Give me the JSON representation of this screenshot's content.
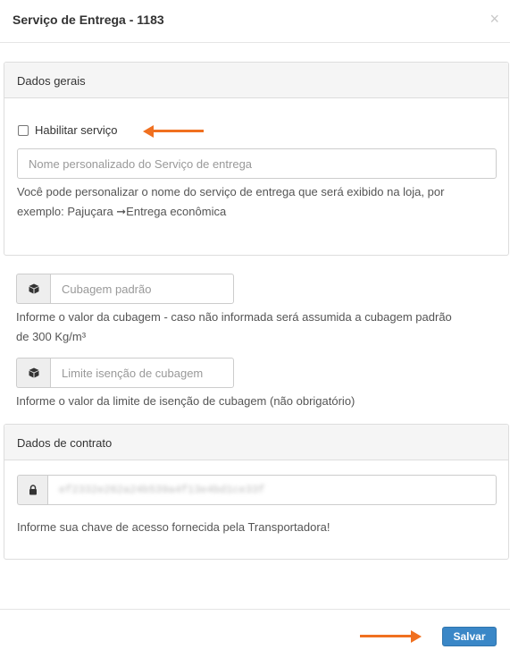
{
  "modal": {
    "title": "Serviço de Entrega - 1183",
    "close_icon": "×"
  },
  "general": {
    "heading": "Dados gerais",
    "enable_label": "Habilitar serviço",
    "enable_checked": false,
    "name_placeholder": "Nome personalizado do Serviço de entrega",
    "help_line1": "Você pode personalizar o nome do serviço de entrega que será exibido na loja, por",
    "help_line2": "exemplo: Pajuçara ➞Entrega econômica"
  },
  "cubage": {
    "placeholder": "Cubagem padrão",
    "icon": "cube-icon",
    "help_line1": "Informe o valor da cubagem - caso não informada será assumida a cubagem padrão",
    "help_line2": "de 300 Kg/m³"
  },
  "exemption": {
    "placeholder": "Limite isenção de cubagem",
    "icon": "cube-icon",
    "help": "Informe o valor da limite de isenção de cubagem (não obrigatório)"
  },
  "contract": {
    "heading": "Dados de contrato",
    "icon": "lock-icon",
    "key_value": "ef2332e262a24b539a4f13e4bd1ce33f",
    "help": "Informe sua chave de acesso fornecida pela Transportadora!"
  },
  "footer": {
    "save_label": "Salvar"
  },
  "colors": {
    "arrow": "#f07020",
    "primary": "#3a87c7"
  }
}
